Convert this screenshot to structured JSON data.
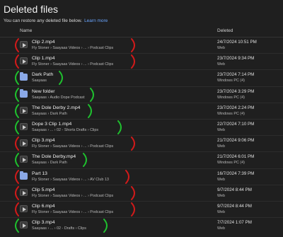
{
  "page": {
    "title": "Deleted files",
    "subtitle": "You can restore any deleted file below.",
    "learn_more": "Learn more"
  },
  "columns": {
    "name": "Name",
    "deleted": "Deleted"
  },
  "colors": {
    "red_mark": "#d11a1a",
    "green_mark": "#1fbf2e",
    "folder": "#8aa8e6",
    "link": "#6aa6ff"
  },
  "rows": [
    {
      "name": "Clip 2.mp4",
      "path": "Fly Stoner › Saayaas Videos › ... › Podcast Clips",
      "date": "24/7/2024 10:51 PM",
      "location": "Web",
      "icon": "video-icon",
      "mark": "red"
    },
    {
      "name": "Clip 1.mp4",
      "path": "Fly Stoner › Saayaas Videos › ... › Podcast Clips",
      "date": "23/7/2024 9:34 PM",
      "location": "Web",
      "icon": "video-icon",
      "mark": "red"
    },
    {
      "name": "Dark Path",
      "path": "Saayaas",
      "date": "23/7/2024 7:14 PM",
      "location": "Windows PC (4)",
      "icon": "folder-icon",
      "mark": "green"
    },
    {
      "name": "New folder",
      "path": "Saayaas › Audio Dope Podcast",
      "date": "23/7/2024 3:29 PM",
      "location": "Windows PC (4)",
      "icon": "folder-icon",
      "mark": "green"
    },
    {
      "name": "The Dole Derby 2.mp4",
      "path": "Saayaas › Dark Path",
      "date": "23/7/2024 2:24 PM",
      "location": "Windows PC (4)",
      "icon": "video-icon",
      "mark": "green"
    },
    {
      "name": "Dope 3 Clip 1.mp4",
      "path": "Saayaas › ... › 02 - Shorts Drafts › Clips",
      "date": "22/7/2024 7:10 PM",
      "location": "Web",
      "icon": "video-icon",
      "mark": "green"
    },
    {
      "name": "Clip 3.mp4",
      "path": "Fly Stoner › Saayaas Videos › ... › Podcast Clips",
      "date": "21/7/2024 9:06 PM",
      "location": "Web",
      "icon": "video-icon",
      "mark": "red"
    },
    {
      "name": "The Dole Derby.mp4",
      "path": "Saayaas › Dark Path",
      "date": "21/7/2024 6:01 PM",
      "location": "Windows PC (4)",
      "icon": "video-icon",
      "mark": "green"
    },
    {
      "name": "Part 13",
      "path": "Fly Stoner › Saayaas Videos › ... › AV Club 13",
      "date": "16/7/2024 7:39 PM",
      "location": "Web",
      "icon": "folder-icon",
      "mark": "red"
    },
    {
      "name": "Clip 5.mp4",
      "path": "Fly Stoner › Saayaas Videos › ... › Podcast Clips",
      "date": "9/7/2024 8:44 PM",
      "location": "Web",
      "icon": "video-icon",
      "mark": "red"
    },
    {
      "name": "Clip 6.mp4",
      "path": "Fly Stoner › Saayaas Videos › ... › Podcast Clips",
      "date": "9/7/2024 8:44 PM",
      "location": "Web",
      "icon": "video-icon",
      "mark": "red"
    },
    {
      "name": "Clip 3.mp4",
      "path": "Saayaas › ... › 02 - Drafts › Clips",
      "date": "7/7/2024 1:07 PM",
      "location": "Web",
      "icon": "video-icon",
      "mark": "green"
    }
  ]
}
